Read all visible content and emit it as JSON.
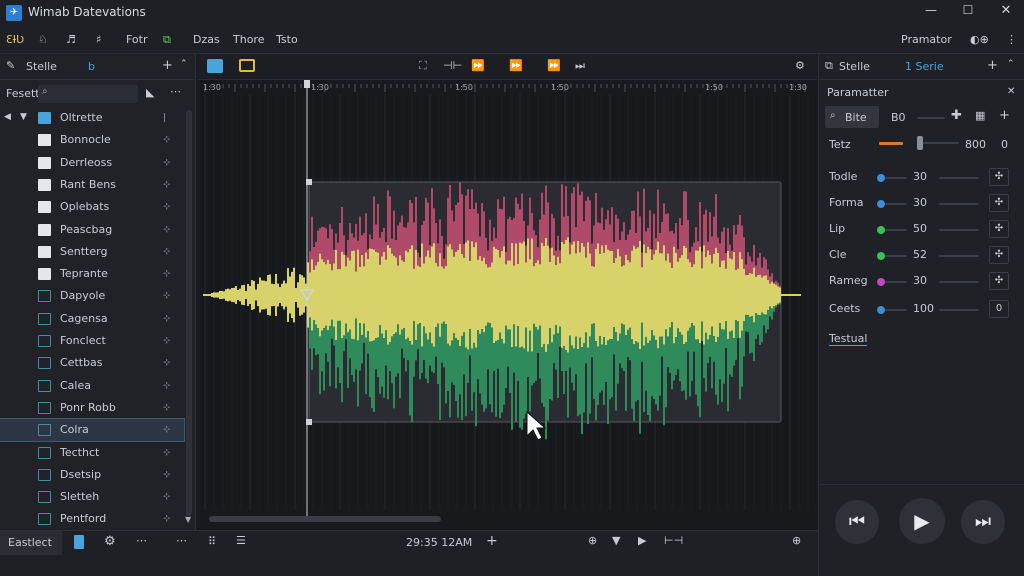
{
  "window": {
    "title": "Wimab Datevations",
    "controls": [
      "—",
      "☐",
      "✕"
    ]
  },
  "toolbar": {
    "left_items": [
      "ƐƗƲ",
      "♘",
      "♬",
      "♯"
    ],
    "menus": [
      "Fotr",
      "Dzas",
      "Thore",
      "Tsto"
    ],
    "right_label": "Pramator"
  },
  "left_panel": {
    "tab": "Stelle",
    "tab2": "b",
    "search_label": "Fesett",
    "items": [
      {
        "label": "Oltrette",
        "type": "folder-blue"
      },
      {
        "label": "Bonnocle",
        "type": "folder"
      },
      {
        "label": "Derrleoss",
        "type": "folder"
      },
      {
        "label": "Rant Bens",
        "type": "folder"
      },
      {
        "label": "Oplebats",
        "type": "folder"
      },
      {
        "label": "Peascbag",
        "type": "folder"
      },
      {
        "label": "Sentterg",
        "type": "folder"
      },
      {
        "label": "Teprante",
        "type": "folder"
      },
      {
        "label": "Dapyole",
        "type": "doc"
      },
      {
        "label": "Cagensa",
        "type": "doc"
      },
      {
        "label": "Fonclect",
        "type": "doc"
      },
      {
        "label": "Cettbas",
        "type": "doc"
      },
      {
        "label": "Calea",
        "type": "doc"
      },
      {
        "label": "Ponr Robb",
        "type": "doc"
      },
      {
        "label": "Colra",
        "type": "doc",
        "selected": true
      },
      {
        "label": "Tecthct",
        "type": "doc"
      },
      {
        "label": "Dsetsip",
        "type": "doc"
      },
      {
        "label": "Sletteh",
        "type": "doc"
      },
      {
        "label": "Pentford",
        "type": "doc"
      }
    ]
  },
  "timeline": {
    "ruler": [
      "1:30",
      "1:30",
      "1:50",
      "1:50",
      "1:50",
      "1:30"
    ]
  },
  "bottom": {
    "left_label": "Eastlect",
    "time": "29:35 12AM"
  },
  "right_panel": {
    "tab": "Stelle",
    "tab2": "1 Serie",
    "header": "Paramatter",
    "row1": {
      "label": "Bite",
      "value": "B0"
    },
    "row2": {
      "label": "Tetz",
      "value": "800",
      "value2": "0"
    },
    "params": [
      {
        "label": "Todle",
        "value": "30",
        "color": "#3a8fd8"
      },
      {
        "label": "Forma",
        "value": "30",
        "color": "#3a8fd8"
      },
      {
        "label": "Lip",
        "value": "50",
        "color": "#3bbf5a"
      },
      {
        "label": "Cle",
        "value": "52",
        "color": "#3bbf5a"
      },
      {
        "label": "Rameg",
        "value": "30",
        "color": "#c04bc0"
      },
      {
        "label": "Ceets",
        "value": "100",
        "color": "#3a8fd8",
        "value2": "0"
      }
    ],
    "link": "Testual"
  },
  "colors": {
    "accent": "#4aa3df",
    "wave_yellow": "#d7d36a",
    "wave_red": "#b04a6a",
    "wave_green": "#2f8a5c"
  }
}
